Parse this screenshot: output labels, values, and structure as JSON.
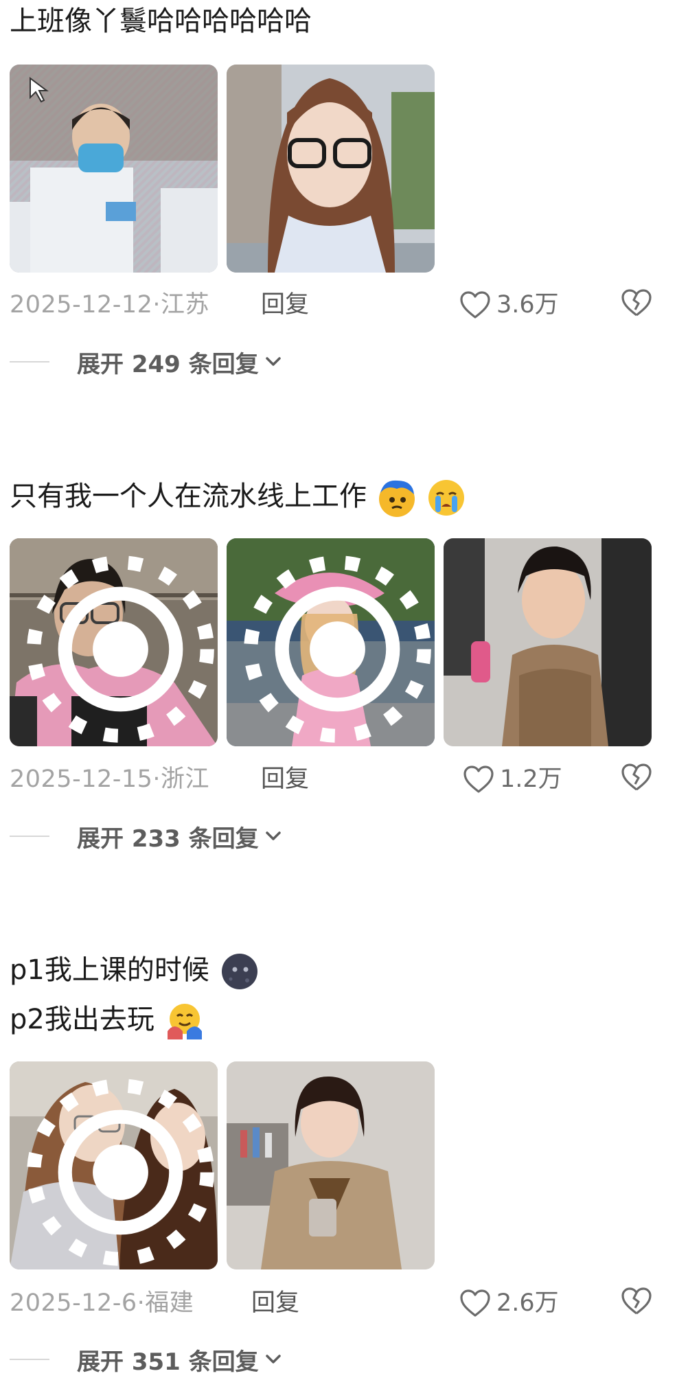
{
  "comments": [
    {
      "text": "上班像丫鬟哈哈哈哈哈哈",
      "emojis": [],
      "date": "2025-12-12",
      "location": "江苏",
      "reply_label": "回复",
      "likes": "3.6万",
      "expand_label": "展开 249 条回复",
      "images": [
        {
          "icon": "photo",
          "live": false
        },
        {
          "icon": "photo",
          "live": false
        }
      ]
    },
    {
      "text": "只有我一个人在流水线上工作",
      "emojis": [
        "dizzy-face-emoji",
        "crying-face-emoji"
      ],
      "date": "2025-12-15",
      "location": "浙江",
      "reply_label": "回复",
      "likes": "1.2万",
      "expand_label": "展开 233 条回复",
      "images": [
        {
          "icon": "photo",
          "live": true
        },
        {
          "icon": "photo",
          "live": true
        },
        {
          "icon": "photo",
          "live": false
        }
      ]
    },
    {
      "text_line1": "p1我上课的时候",
      "text_line2": "p2我出去玩",
      "emojis": [
        "new-moon-face-emoji",
        "hugging-face-emoji"
      ],
      "date": "2025-12-6",
      "location": "福建",
      "reply_label": "回复",
      "likes": "2.6万",
      "expand_label": "展开 351 条回复",
      "images": [
        {
          "icon": "photo",
          "live": true
        },
        {
          "icon": "photo",
          "live": false
        }
      ]
    }
  ],
  "separator": "·",
  "colors": {
    "text": "#1a1a1a",
    "meta": "#a3a3a3",
    "reply": "#555555",
    "expand": "#5c5c5c"
  }
}
